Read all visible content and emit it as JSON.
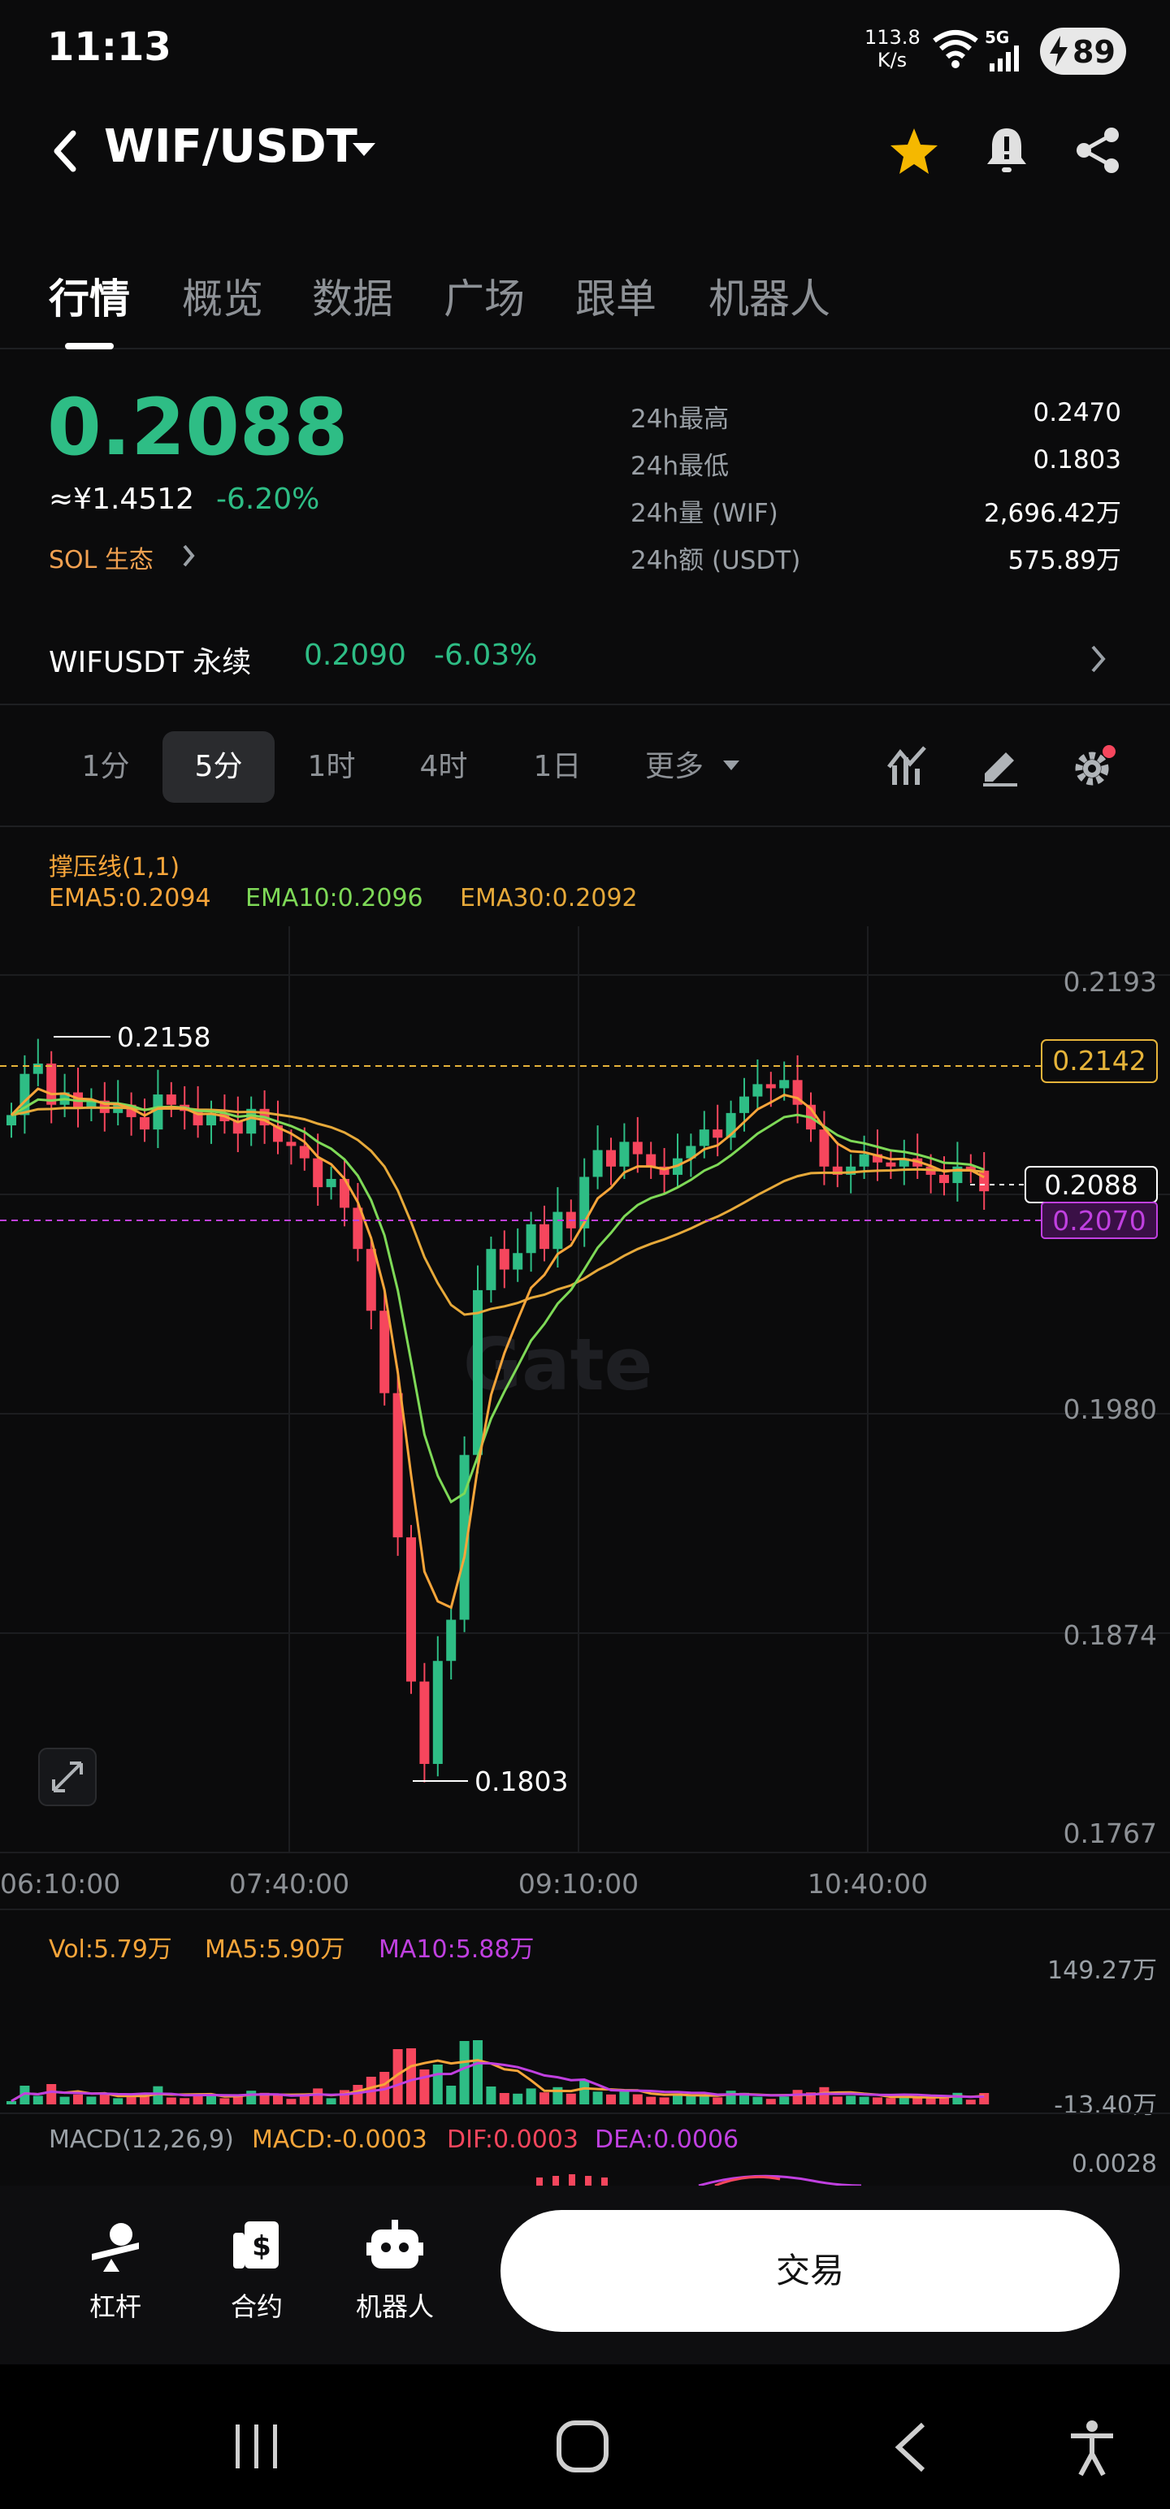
{
  "status_bar": {
    "time": "11:13",
    "net_speed_top": "113.8",
    "net_speed_bottom": "K/s",
    "net_type": "5G",
    "battery": "89"
  },
  "header": {
    "pair": "WIF/USDT"
  },
  "tabs": [
    {
      "label": "行情",
      "active": true
    },
    {
      "label": "概览"
    },
    {
      "label": "数据"
    },
    {
      "label": "广场"
    },
    {
      "label": "跟单"
    },
    {
      "label": "机器人"
    }
  ],
  "price": {
    "last": "0.2088",
    "cny": "≈¥1.4512",
    "change": "-6.20%",
    "ecosystem": "SOL 生态",
    "stats": [
      {
        "label": "24h最高",
        "value": "0.2470"
      },
      {
        "label": "24h最低",
        "value": "0.1803"
      },
      {
        "label": "24h量 (WIF)",
        "value": "2,696.42万"
      },
      {
        "label": "24h额 (USDT)",
        "value": "575.89万"
      }
    ]
  },
  "perp": {
    "name": "WIFUSDT 永续",
    "price": "0.2090",
    "change": "-6.03%"
  },
  "timeframes": [
    "1分",
    "5分",
    "1时",
    "4时",
    "1日"
  ],
  "timeframe_active": "5分",
  "more_label": "更多",
  "indicators": {
    "sr_line": "撑压线(1,1)",
    "ema5": "EMA5:0.2094",
    "ema10": "EMA10:0.2096",
    "ema30": "EMA30:0.2092"
  },
  "chart": {
    "axis_prices": [
      "0.2193",
      "0.1980",
      "0.1874",
      "0.1767"
    ],
    "level_tags": {
      "resistance": "0.2142",
      "current": "0.2088",
      "support": "0.2070"
    },
    "high_label": "0.2158",
    "low_label": "0.1803",
    "time_labels": [
      "06:10:00",
      "07:40:00",
      "09:10:00",
      "10:40:00"
    ],
    "watermark": "Gate",
    "colors": {
      "up": "#2ebd85",
      "down": "#f6465d",
      "ema5": "#f7a53a",
      "ema10": "#7ed957",
      "ema30": "#e6a93a",
      "resistance": "#e6b43a",
      "support": "#c040e0"
    }
  },
  "volume": {
    "vol": "Vol:5.79万",
    "ma5": "MA5:5.90万",
    "ma10": "MA10:5.88万",
    "axis_top": "149.27万",
    "axis_bottom": "-13.40万"
  },
  "macd": {
    "title": "MACD(12,26,9)",
    "macd": "MACD:-0.0003",
    "dif": "DIF:0.0003",
    "dea": "DEA:0.0006",
    "axis": "0.0028"
  },
  "bottom_nav": {
    "items": [
      {
        "label": "杠杆",
        "icon": "leverage-icon"
      },
      {
        "label": "合约",
        "icon": "contract-icon"
      },
      {
        "label": "机器人",
        "icon": "robot-icon"
      }
    ],
    "trade_button": "交易"
  }
}
